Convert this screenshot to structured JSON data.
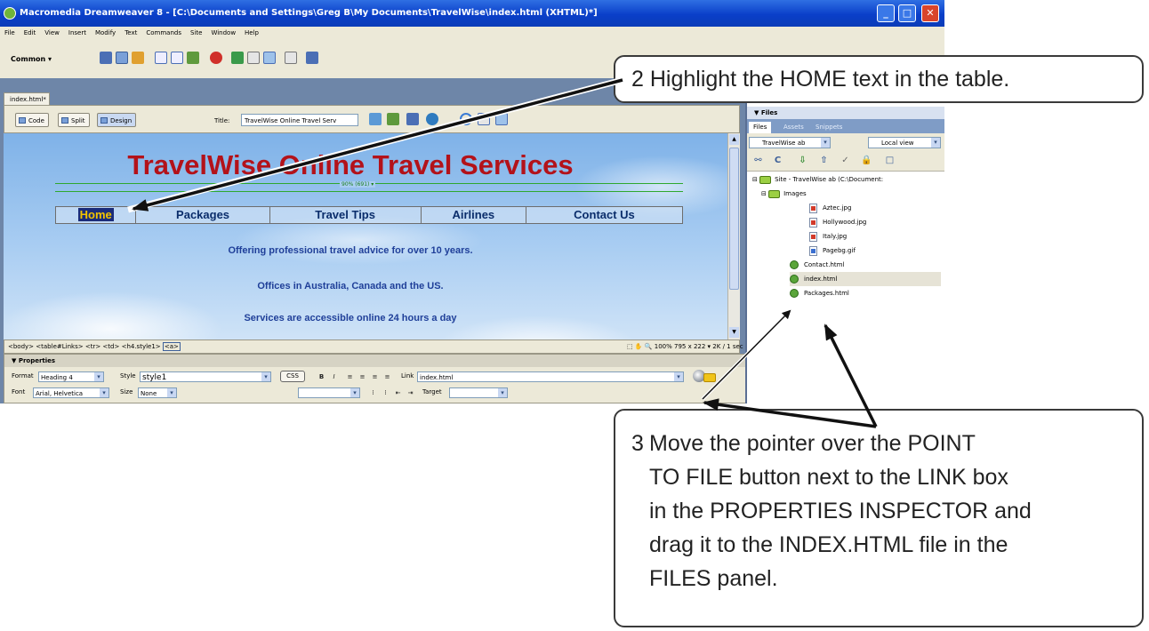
{
  "window": {
    "title": "Macromedia Dreamweaver 8 - [C:\\Documents and Settings\\Greg B\\My Documents\\TravelWise\\index.html (XHTML)*]",
    "controls": [
      "_",
      "□",
      "✕"
    ]
  },
  "menu": [
    "File",
    "Edit",
    "View",
    "Insert",
    "Modify",
    "Text",
    "Commands",
    "Site",
    "Window",
    "Help"
  ],
  "insert_bar": {
    "category": "Common"
  },
  "document": {
    "tab": "index.html*",
    "views": [
      "Code",
      "Split",
      "Design"
    ],
    "title_label": "Title:",
    "title_value": "TravelWise Online Travel Serv"
  },
  "page": {
    "heading": "TravelWise Online Travel Services",
    "width_label": "90% (691) ▾",
    "nav": [
      "Home",
      "Packages",
      "Travel Tips",
      "Airlines",
      "Contact Us"
    ],
    "lines": [
      "Offering professional travel advice for over 10 years.",
      "Offices in Australia, Canada and the US.",
      "Services are accessible online 24 hours a day"
    ]
  },
  "statusbar": {
    "tags": [
      "<body>",
      "<table#Links>",
      "<tr>",
      "<td>",
      "<h4.style1>",
      "<a>"
    ],
    "zoom": "100%",
    "size": "795 x 222 ▾  2K / 1 sec"
  },
  "properties": {
    "title": "▼ Properties",
    "format_label": "Format",
    "format_value": "Heading 4",
    "style_label": "Style",
    "style_value": "style1",
    "css_label": "CSS",
    "link_label": "Link",
    "link_value": "index.html",
    "font_label": "Font",
    "font_value": "Arial, Helvetica",
    "size_label": "Size",
    "size_value": "None",
    "target_label": "Target"
  },
  "files_panel": {
    "title": "▼ Files",
    "tabs": [
      "Files",
      "Assets",
      "Snippets"
    ],
    "site_select": "TravelWise ab",
    "view_select": "Local view",
    "tree": [
      {
        "label": "Site - TravelWise ab (C:\\Document:",
        "icon": "site-folder",
        "level": 0
      },
      {
        "label": "Images",
        "icon": "folder",
        "level": 1
      },
      {
        "label": "Aztec.jpg",
        "icon": "image",
        "level": 2
      },
      {
        "label": "Hollywood.jpg",
        "icon": "image",
        "level": 2
      },
      {
        "label": "Italy.jpg",
        "icon": "image",
        "level": 2
      },
      {
        "label": "Pagebg.gif",
        "icon": "image",
        "level": 2
      },
      {
        "label": "Contact.html",
        "icon": "html",
        "level": 1
      },
      {
        "label": "index.html",
        "icon": "html",
        "level": 1
      },
      {
        "label": "Packages.html",
        "icon": "html",
        "level": 1
      }
    ]
  },
  "callouts": {
    "step2": "2  Highlight the HOME text in the table.",
    "step3_num": "3",
    "step3_lines": [
      "Move the pointer over the POINT",
      "TO FILE button next to the LINK box",
      "in the PROPERTIES INSPECTOR and",
      "drag it to the INDEX.HTML file in the",
      "FILES panel."
    ]
  }
}
